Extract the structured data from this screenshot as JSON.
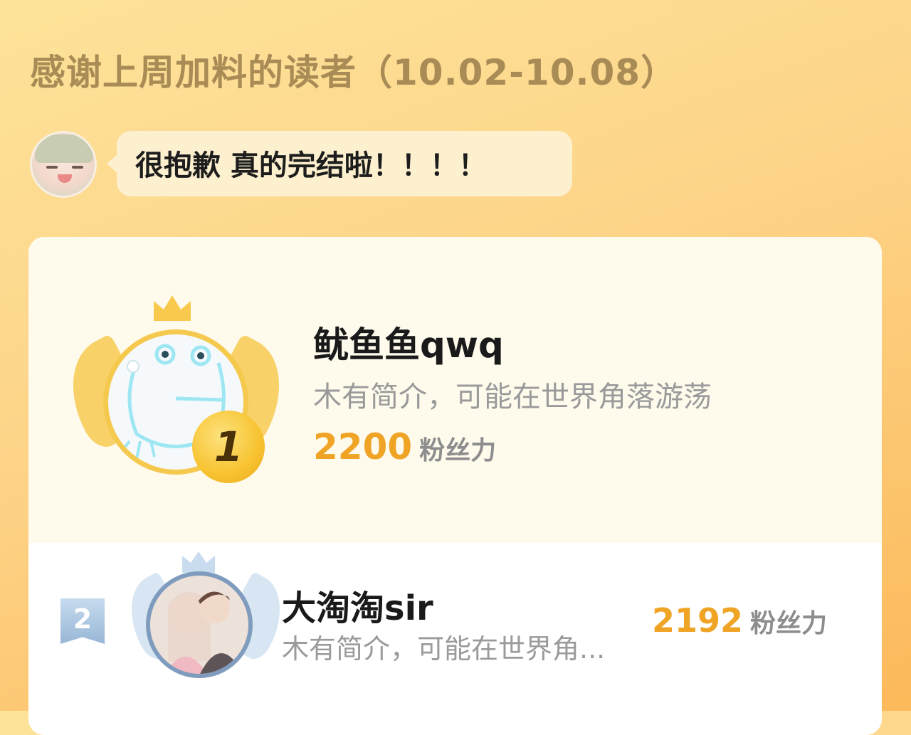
{
  "header": {
    "title": "感谢上周加料的读者（10.02-10.08）"
  },
  "author_message": {
    "text": "很抱歉 真的完结啦！！！！"
  },
  "ranking": [
    {
      "rank": "1",
      "name": "鱿鱼鱼qwq",
      "bio": "木有简介，可能在世界角落游荡",
      "score": "2200",
      "unit": "粉丝力"
    },
    {
      "rank": "2",
      "name": "大淘淘sir",
      "bio": "木有简介，可能在世界角...",
      "score": "2192",
      "unit": "粉丝力"
    }
  ],
  "colors": {
    "accent": "#f0a425",
    "title": "#a88b55",
    "gold": "#f5c94e",
    "silver": "#7f9bbd"
  },
  "icons": [
    "crown-icon",
    "medal-icon",
    "wing-icon"
  ]
}
